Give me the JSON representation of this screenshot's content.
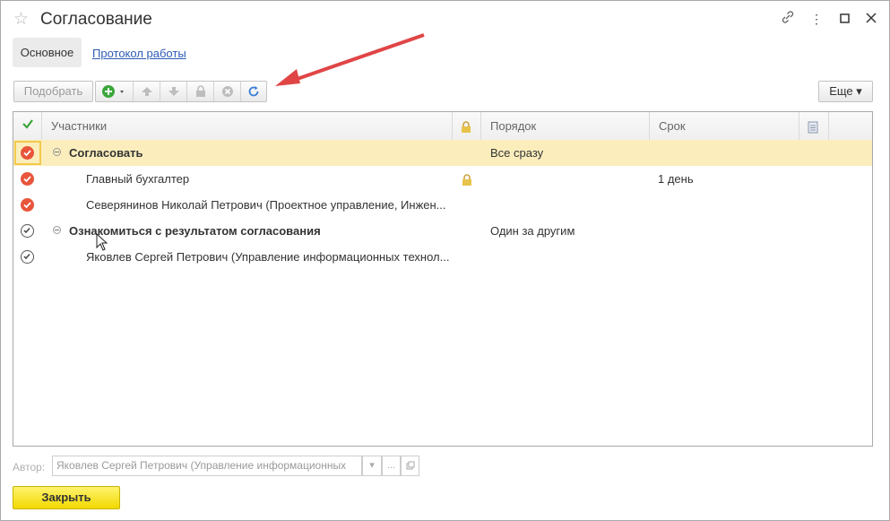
{
  "window": {
    "title": "Согласование"
  },
  "tabs": {
    "main": "Основное",
    "protocol": "Протокол работы"
  },
  "toolbar": {
    "pick_label": "Подобрать",
    "more_label": "Еще"
  },
  "table": {
    "columns": {
      "participants": "Участники",
      "order": "Порядок",
      "term": "Срок"
    },
    "rows": [
      {
        "name": "Согласовать",
        "order": "Все сразу",
        "term": ""
      },
      {
        "name": "Главный бухгалтер",
        "order": "",
        "term": "1 день"
      },
      {
        "name": "Северянинов Николай Петрович (Проектное управление, Инжен...",
        "order": "",
        "term": ""
      },
      {
        "name": "Ознакомиться с результатом согласования",
        "order": "Один за другим",
        "term": ""
      },
      {
        "name": "Яковлев Сергей Петрович (Управление информационных технол...",
        "order": "",
        "term": ""
      }
    ]
  },
  "footer": {
    "author_label": "Автор:",
    "author_value": "Яковлев Сергей Петрович (Управление информационных",
    "more_btn": "...",
    "close_label": "Закрыть"
  },
  "colors": {
    "accent_red": "#e8553b",
    "selection": "#fbeebc",
    "close_yellow": "#f1d900",
    "annotation_arrow": "#e04545"
  }
}
